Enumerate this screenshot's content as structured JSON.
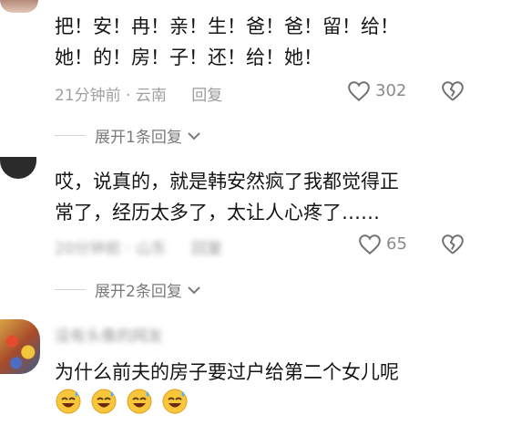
{
  "comments": [
    {
      "text_line1": "把！安！冉！亲！生！爸！爸！留！给！",
      "text_line2": "她！的！房！子！还！给！她！",
      "time_location": "21分钟前 · 云南",
      "reply_label": "回复",
      "likes": "302",
      "expand_label": "展开1条回复"
    },
    {
      "text_line1": "哎，说真的，就是韩安然疯了我都觉得正",
      "text_line2": "常了，经历太多了，太让人心疼了……",
      "time_location": "20分钟前 · 山东",
      "reply_label": "回复",
      "likes": "65",
      "expand_label": "展开2条回复"
    },
    {
      "username": "没有头像的网友",
      "text_line1": "为什么前夫的房子要过户给第二个女儿呢",
      "emojis": [
        "😅",
        "😅",
        "😅",
        "😅"
      ]
    }
  ],
  "colors": {
    "accent_orange": "#f2b13c",
    "text": "#151515",
    "meta": "#a0a0a0"
  },
  "icons": {
    "like": "heart-outline-icon",
    "dislike": "broken-heart-icon",
    "expand": "chevron-down-icon"
  }
}
